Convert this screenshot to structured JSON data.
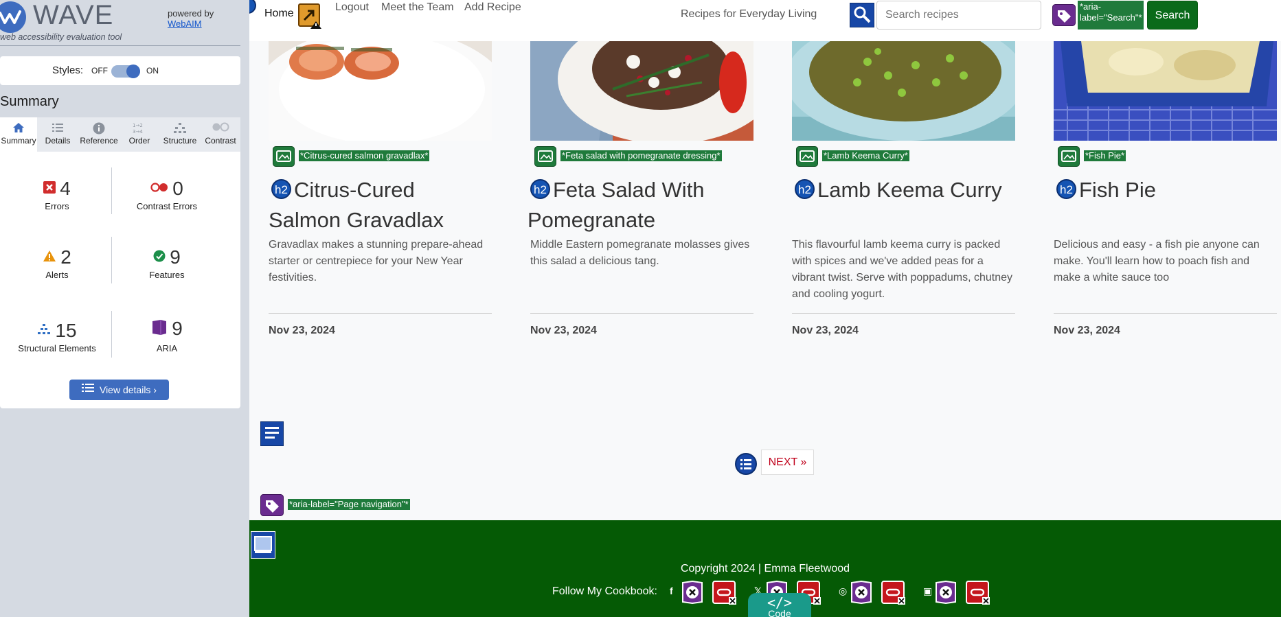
{
  "wave": {
    "logo_text": "WAVE",
    "tagline": "web accessibility evaluation tool",
    "powered_by": "powered by",
    "powered_link": "WebAIM",
    "styles_label": "Styles:",
    "off_label": "OFF",
    "on_label": "ON",
    "styles_on": true,
    "summary_heading": "Summary",
    "tabs": [
      {
        "label": "Summary",
        "icon": "home-icon",
        "active": true
      },
      {
        "label": "Details",
        "icon": "list-icon",
        "active": false
      },
      {
        "label": "Reference",
        "icon": "info-icon",
        "active": false
      },
      {
        "label": "Order",
        "icon": "order-icon",
        "active": false
      },
      {
        "label": "Structure",
        "icon": "structure-icon",
        "active": false
      },
      {
        "label": "Contrast",
        "icon": "contrast-icon",
        "active": false
      }
    ],
    "stats": {
      "errors": {
        "count": "4",
        "label": "Errors"
      },
      "contrast_errors": {
        "count": "0",
        "label": "Contrast Errors"
      },
      "alerts": {
        "count": "2",
        "label": "Alerts"
      },
      "features": {
        "count": "9",
        "label": "Features"
      },
      "structural": {
        "count": "15",
        "label": "Structural Elements"
      },
      "aria": {
        "count": "9",
        "label": "ARIA"
      }
    },
    "view_details": "View details ›"
  },
  "site": {
    "nav": {
      "home": "Home",
      "logout": "Logout",
      "team": "Meet the Team",
      "add": "Add Recipe"
    },
    "tagline": "Recipes for Everyday Living",
    "search_placeholder": "Search recipes",
    "search_aria": "*aria-label=\"Search\"*",
    "search_button": "Search",
    "cards": [
      {
        "alt": "*Citrus-cured salmon gravadlax*",
        "title": "Citrus-Cured Salmon Gravadlax",
        "desc": "Gravadlax makes a stunning prepare-ahead starter or centrepiece for your New Year festivities.",
        "date": "Nov 23, 2024"
      },
      {
        "alt": "*Feta salad with pomegranate dressing*",
        "title": "Feta Salad With Pomegranate",
        "desc": "Middle Eastern pomegranate molasses gives this salad a delicious tang.",
        "date": "Nov 23, 2024"
      },
      {
        "alt": "*Lamb Keema Curry*",
        "title": "Lamb Keema Curry",
        "desc": "This flavourful lamb keema curry is packed with spices and we've added peas for a vibrant twist. Serve with poppadums, chutney and cooling yogurt.",
        "date": "Nov 23, 2024"
      },
      {
        "alt": "*Fish Pie*",
        "title": "Fish Pie",
        "desc": "Delicious and easy - a fish pie anyone can make. You'll learn how to poach fish and make a white sauce too",
        "date": "Nov 23, 2024"
      }
    ],
    "h2_badge": "h2",
    "next_label": "NEXT »",
    "pagination_aria": "*aria-label=\"Page navigation\"*",
    "copyright": "Copyright 2024 | Emma Fleetwood",
    "follow": "Follow My Cookbook:",
    "code_tab": "Code",
    "colors": {
      "footer": "#055a05",
      "search_button": "#0a6a1a",
      "wave_blue": "#3e6cbf",
      "next_text": "#c0001a"
    }
  }
}
